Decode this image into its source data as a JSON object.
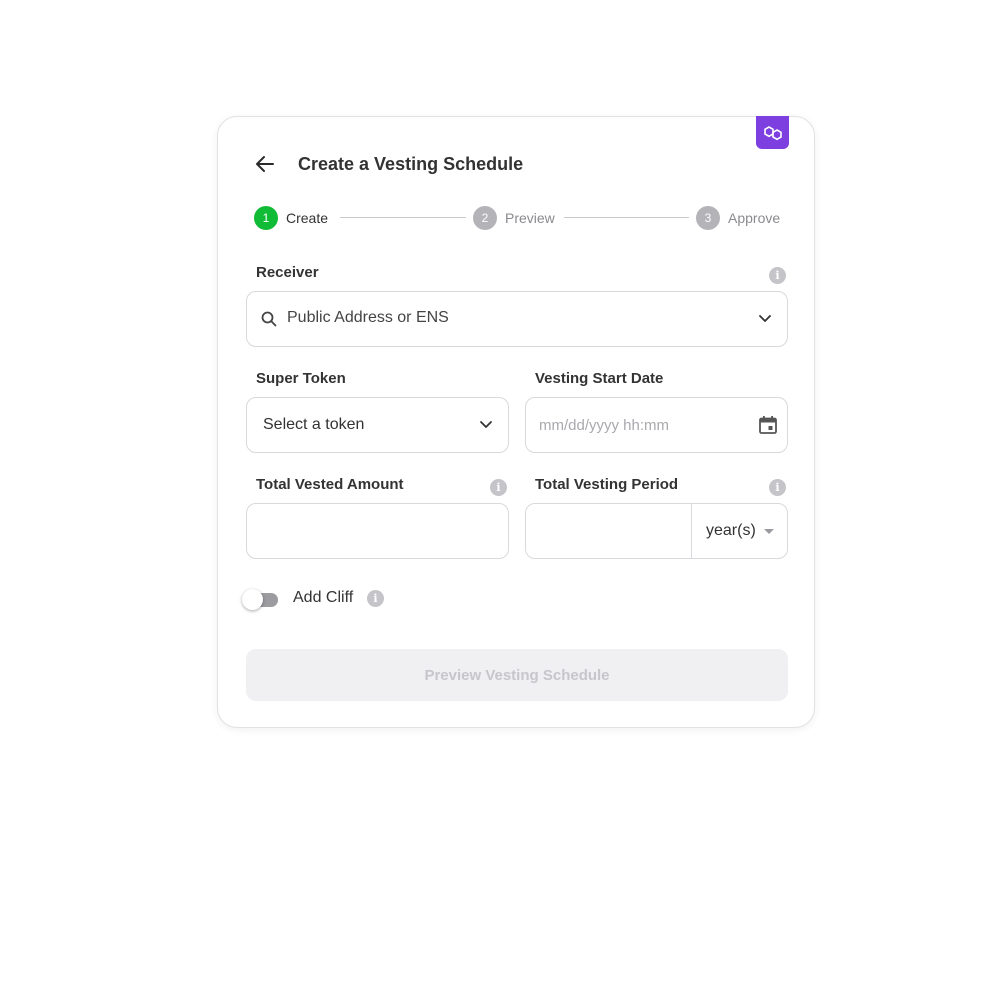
{
  "header": {
    "title": "Create a Vesting Schedule"
  },
  "stepper": {
    "steps": [
      {
        "number": "1",
        "label": "Create",
        "active": true
      },
      {
        "number": "2",
        "label": "Preview",
        "active": false
      },
      {
        "number": "3",
        "label": "Approve",
        "active": false
      }
    ]
  },
  "receiver": {
    "label": "Receiver",
    "placeholder": "Public Address or ENS"
  },
  "super_token": {
    "label": "Super Token",
    "value": "Select a token"
  },
  "vesting_start": {
    "label": "Vesting Start Date",
    "placeholder": "mm/dd/yyyy hh:mm"
  },
  "vested_amount": {
    "label": "Total Vested Amount",
    "value": ""
  },
  "vesting_period": {
    "label": "Total Vesting Period",
    "value": "",
    "unit": "year(s)"
  },
  "cliff": {
    "label": "Add Cliff",
    "enabled": false
  },
  "info_glyph": "i",
  "actions": {
    "preview_label": "Preview Vesting Schedule"
  },
  "colors": {
    "accent_green": "#10bb35",
    "network_purple": "#7d3fe0",
    "disabled_button": "#f0f0f3"
  }
}
